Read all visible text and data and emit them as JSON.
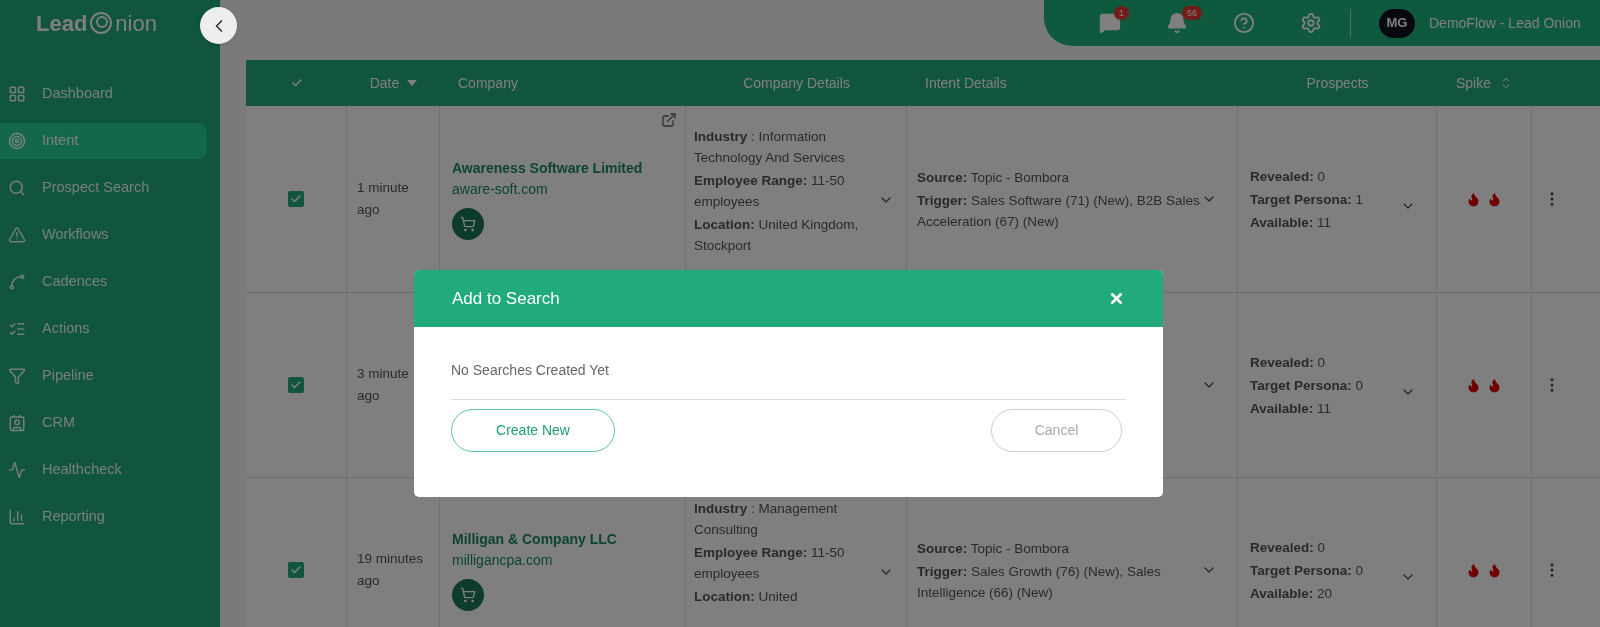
{
  "sidebar": {
    "logo": {
      "before_mark": "Lead",
      "after_mark": "nion"
    },
    "items": [
      {
        "label": "Dashboard",
        "selected": false
      },
      {
        "label": "Intent",
        "selected": true
      },
      {
        "label": "Prospect Search",
        "selected": false
      },
      {
        "label": "Workflows",
        "selected": false
      },
      {
        "label": "Cadences",
        "selected": false
      },
      {
        "label": "Actions",
        "selected": false
      },
      {
        "label": "Pipeline",
        "selected": false
      },
      {
        "label": "CRM",
        "selected": false
      },
      {
        "label": "Healthcheck",
        "selected": false
      },
      {
        "label": "Reporting",
        "selected": false
      }
    ]
  },
  "topbar": {
    "messages_badge": "1",
    "notifications_badge": "56",
    "avatar": "MG",
    "account": "DemoFlow - Lead Onion"
  },
  "table": {
    "select_all_checked": true,
    "columns": [
      {
        "label": "Date"
      },
      {
        "label": "Company"
      },
      {
        "label": "Company Details"
      },
      {
        "label": "Intent Details"
      },
      {
        "label": "Prospects"
      },
      {
        "label": "Spike"
      }
    ],
    "rows": [
      {
        "checked": true,
        "date": "1 minute ago",
        "company": {
          "name": "Awareness Software Limited",
          "domain": "aware-soft.com",
          "external_link": true
        },
        "details": [
          "**Industry** : Information Technology And Services",
          "**Employee Range:**  11-50 employees",
          "**Location:**  United Kingdom, Stockport"
        ],
        "intent": [
          "**Source:** Topic - Bombora",
          "**Trigger:** Sales Software (71) (New), B2B Sales Acceleration (67) (New)"
        ],
        "prospects": [
          "**Revealed:**  0",
          "**Target Persona:**  1",
          "**Available:**  11"
        ]
      },
      {
        "checked": true,
        "date": "3 minute ago",
        "prospects": [
          "**Revealed:**  0",
          "**Target Persona:**  0",
          "**Available:**  11"
        ]
      },
      {
        "checked": true,
        "date": "19 minutes ago",
        "company": {
          "name": "Milligan & Company LLC",
          "domain": "milligancpa.com",
          "external_link": false
        },
        "details": [
          "**Industry** : Management Consulting",
          "**Employee Range:**  11-50 employees",
          "**Location:**  United"
        ],
        "intent": [
          "**Source:** Topic - Bombora",
          "**Trigger:** Sales Growth (76) (New), Sales Intelligence (66) (New)"
        ],
        "prospects": [
          "**Revealed:**  0",
          "**Target Persona:**  0",
          "**Available:**  20"
        ]
      }
    ]
  },
  "modal": {
    "title": "Add to Search",
    "message": "No Searches Created Yet",
    "primary_button": "Create New",
    "secondary_button": "Cancel"
  }
}
